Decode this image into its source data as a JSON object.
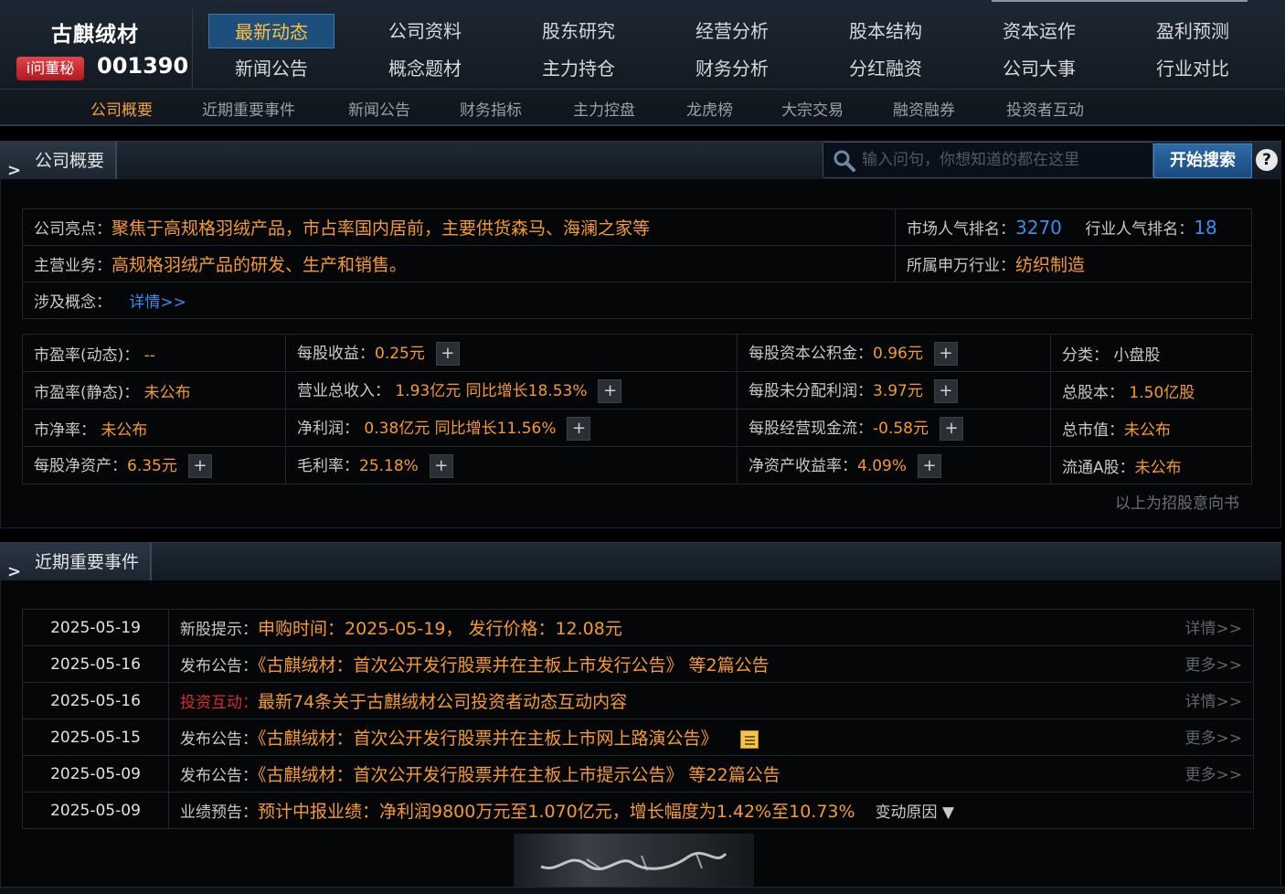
{
  "brand": {
    "company": "古麒绒材",
    "badge": "i问董秘",
    "code": "001390"
  },
  "nav": {
    "row1": [
      "最新动态",
      "公司资料",
      "股东研究",
      "经营分析",
      "股本结构",
      "资本运作",
      "盈利预测"
    ],
    "row2": [
      "新闻公告",
      "概念题材",
      "主力持仓",
      "财务分析",
      "分红融资",
      "公司大事",
      "行业对比"
    ],
    "sub": [
      "公司概要",
      "近期重要事件",
      "新闻公告",
      "财务指标",
      "主力控盘",
      "龙虎榜",
      "大宗交易",
      "融资融券",
      "投资者互动"
    ]
  },
  "overview": {
    "title": "公司概要",
    "search": {
      "placeholder": "输入问句，你想知道的都在这里",
      "button": "开始搜索",
      "help": "?"
    },
    "highlight_label": "公司亮点：",
    "highlight_text": "聚焦于高规格羽绒产品，市占率国内居前，主要供货森马、海澜之家等",
    "business_label": "主营业务：",
    "business_text": "高规格羽绒产品的研发、生产和销售。",
    "concept_label": "涉及概念：",
    "concept_link": "详情>>",
    "market_rank_label": "市场人气排名：",
    "market_rank": "3270",
    "industry_rank_label": "行业人气排名：",
    "industry_rank": "18",
    "sw_industry_label": "所属申万行业：",
    "sw_industry": "纺织制造",
    "metrics": {
      "pe_dynamic_label": "市盈率(动态)：",
      "pe_dynamic": "--",
      "pe_static_label": "市盈率(静态)：",
      "pe_static": "未公布",
      "pb_label": "市净率：",
      "pb": "未公布",
      "bvps_label": "每股净资产：",
      "bvps": "6.35元",
      "eps_label": "每股收益：",
      "eps": "0.25元",
      "revenue_label": "营业总收入：",
      "revenue": "1.93亿元 同比增长18.53%",
      "net_profit_label": "净利润：",
      "net_profit": "0.38亿元 同比增长11.56%",
      "gross_margin_label": "毛利率：",
      "gross_margin": "25.18%",
      "capital_reserve_label": "每股资本公积金：",
      "capital_reserve": "0.96元",
      "undistributed_label": "每股未分配利润：",
      "undistributed": "3.97元",
      "op_cashflow_label": "每股经营现金流：",
      "op_cashflow": "-0.58元",
      "roe_label": "净资产收益率：",
      "roe": "4.09%",
      "category_label": "分类：",
      "category": "小盘股",
      "total_shares_label": "总股本：",
      "total_shares": "1.50亿股",
      "market_cap_label": "总市值：",
      "market_cap": "未公布",
      "float_a_label": "流通A股：",
      "float_a": "未公布",
      "plus": "+"
    },
    "note": "以上为招股意向书"
  },
  "events": {
    "title": "近期重要事件",
    "rows": [
      {
        "date": "2025-05-19",
        "type": "新股提示：",
        "text": "申购时间：2025-05-19， 发行价格：12.08元",
        "more": "详情>>"
      },
      {
        "date": "2025-05-16",
        "type": "发布公告：",
        "text": "《古麒绒材：首次公开发行股票并在主板上市发行公告》 等2篇公告",
        "more": "更多>>"
      },
      {
        "date": "2025-05-16",
        "type": "投资互动：",
        "text": "最新74条关于古麒绒材公司投资者动态互动内容",
        "more": "详情>>"
      },
      {
        "date": "2025-05-15",
        "type": "发布公告：",
        "text": "《古麒绒材：首次公开发行股票并在主板上市网上路演公告》",
        "more": "更多>>"
      },
      {
        "date": "2025-05-09",
        "type": "发布公告：",
        "text": "《古麒绒材：首次公开发行股票并在主板上市提示公告》 等22篇公告",
        "more": "更多>>"
      },
      {
        "date": "2025-05-09",
        "type": "业绩预告：",
        "text": "预计中报业绩：净利润9800万元至1.070亿元，增长幅度为1.42%至10.73%",
        "reason": "变动原因 ▼"
      }
    ]
  },
  "colors": {
    "accent_orange": "#f49a30",
    "link_blue": "#3b8cf0",
    "active_nav": "#ffc13b",
    "alert_red": "#d82b2b"
  }
}
